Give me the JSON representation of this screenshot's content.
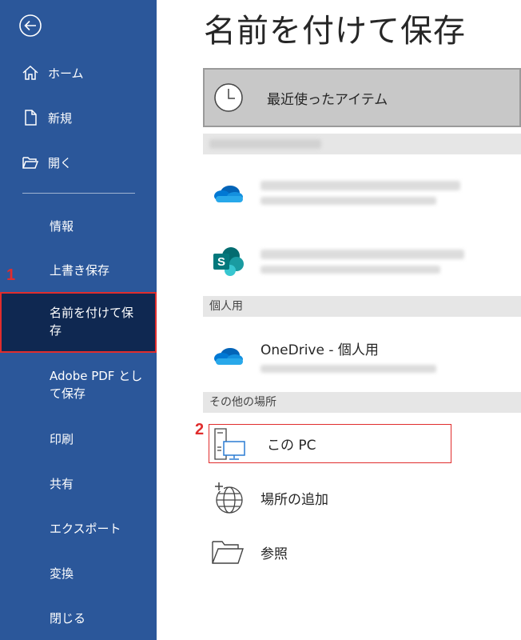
{
  "sidebar": {
    "items": {
      "home": "ホーム",
      "new": "新規",
      "open": "開く",
      "info": "情報",
      "save": "上書き保存",
      "save_as_line1": "名前を付けて保",
      "save_as_line2": "存",
      "adobe_line1": "Adobe PDF とし",
      "adobe_line2": "て保存",
      "print": "印刷",
      "share": "共有",
      "export": "エクスポート",
      "transform": "変換",
      "close": "閉じる"
    },
    "bg_color": "#2b579a",
    "selected_color": "#0f2851"
  },
  "annotations": {
    "step1": "1",
    "step2": "2",
    "color": "#e02d2d"
  },
  "main": {
    "title": "名前を付けて保存",
    "recent_label": "最近使ったアイテム",
    "sections": {
      "personal": "個人用",
      "other": "その他の場所"
    },
    "locations": {
      "onedrive_personal": "OneDrive - 個人用",
      "this_pc": "この PC",
      "add_place": "場所の追加",
      "browse": "参照"
    }
  }
}
